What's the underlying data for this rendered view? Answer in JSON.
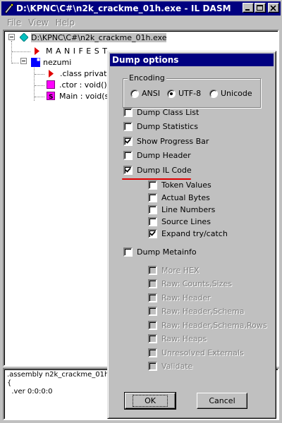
{
  "window": {
    "title": "D:\\KPNC\\C#\\n2k_crackme_01h.exe - IL DASM",
    "buttons": [
      "minimize",
      "maximize",
      "close"
    ]
  },
  "menubar": {
    "items": [
      {
        "label": "File"
      },
      {
        "label": "View"
      },
      {
        "label": "Help"
      }
    ]
  },
  "tree": {
    "root": "D:\\KPNC\\C#\\n2k_crackme_01h.exe",
    "manifest": "M A N I F E S T",
    "namespace": "nezumi",
    "children": [
      {
        "label": ".class private",
        "icon": "red-triangle-icon"
      },
      {
        "label": ".ctor : void()",
        "icon": "magenta-square-icon"
      },
      {
        "label": "Main : void(str",
        "icon": "static-method-icon"
      }
    ]
  },
  "info": {
    "lines": [
      ".assembly n2k_crackme_01h",
      "{",
      "  .ver 0:0:0:0"
    ]
  },
  "dialog": {
    "title": "Dump options",
    "encoding": {
      "legend": "Encoding",
      "options": [
        "ANSI",
        "UTF-8",
        "Unicode"
      ],
      "selected": "UTF-8"
    },
    "options": [
      {
        "label": "Dump Class List",
        "checked": false
      },
      {
        "label": "Dump Statistics",
        "checked": false
      },
      {
        "label": "Show Progress Bar",
        "checked": true
      },
      {
        "label": "Dump Header",
        "checked": false
      },
      {
        "label": "Dump IL Code",
        "checked": true
      }
    ],
    "il_options": [
      {
        "label": "Token Values",
        "checked": false
      },
      {
        "label": "Actual Bytes",
        "checked": false
      },
      {
        "label": "Line Numbers",
        "checked": false
      },
      {
        "label": "Source Lines",
        "checked": false
      },
      {
        "label": "Expand try/catch",
        "checked": true
      }
    ],
    "metainfo": {
      "label": "Dump Metainfo",
      "checked": false
    },
    "meta_options": [
      {
        "label": "More HEX"
      },
      {
        "label": "Raw: Counts,Sizes"
      },
      {
        "label": "Raw: Header"
      },
      {
        "label": "Raw: Header,Schema"
      },
      {
        "label": "Raw: Header,Schema,Rows"
      },
      {
        "label": "Raw: Heaps"
      },
      {
        "label": "Unresolved Externals"
      },
      {
        "label": "Validate"
      }
    ],
    "ok_label": "OK",
    "cancel_label": "Cancel",
    "annotation_color": "#e00000"
  }
}
